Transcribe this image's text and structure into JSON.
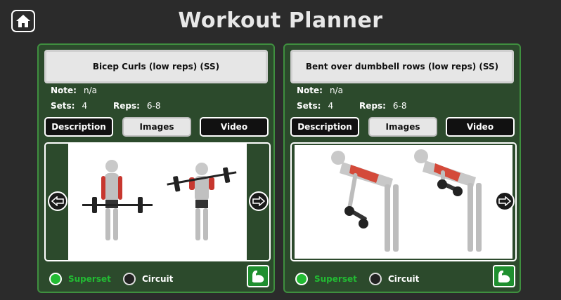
{
  "header": {
    "title": "Workout Planner",
    "home_icon": "home-icon"
  },
  "labels": {
    "note": "Note:",
    "sets": "Sets:",
    "reps": "Reps:",
    "superset": "Superset",
    "circuit": "Circuit"
  },
  "colors": {
    "accent_green": "#22bb33",
    "card_bg": "#2c4a2c",
    "card_border": "#3f8f3f",
    "superset_text": "#22bb33"
  },
  "cards": [
    {
      "name": "Bicep Curls (low reps) (SS)",
      "note": "n/a",
      "sets": "4",
      "reps": "6-8",
      "tabs": [
        "Description",
        "Images",
        "Video"
      ],
      "active_tab": "Images",
      "image_alt": "bicep curl illustration",
      "prev_icon": "arrow-left-icon",
      "next_icon": "arrow-right-icon",
      "superset_selected": true,
      "circuit_selected": false,
      "muscle_icon": "flexed-arm-icon"
    },
    {
      "name": "Bent over dumbbell rows (low reps) (SS)",
      "note": "n/a",
      "sets": "4",
      "reps": "6-8",
      "tabs": [
        "Description",
        "Images",
        "Video"
      ],
      "active_tab": "Images",
      "image_alt": "bent over dumbbell row illustration",
      "next_icon": "arrow-right-icon",
      "superset_selected": true,
      "circuit_selected": false,
      "muscle_icon": "flexed-arm-icon"
    }
  ]
}
